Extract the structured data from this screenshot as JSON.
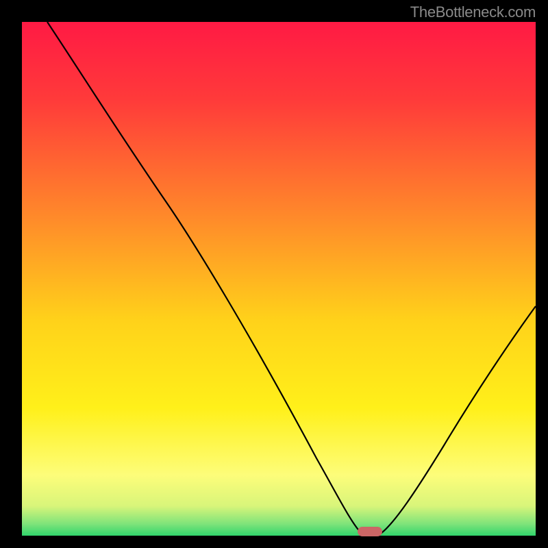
{
  "watermark": "TheBottleneck.com",
  "chart_data": {
    "type": "line",
    "title": "",
    "xlabel": "",
    "ylabel": "",
    "x_range": [
      0,
      100
    ],
    "y_range": [
      0,
      100
    ],
    "background": {
      "type": "vertical_gradient",
      "stops": [
        {
          "pos": 0.0,
          "color": "#ff1a44"
        },
        {
          "pos": 0.15,
          "color": "#ff3a3a"
        },
        {
          "pos": 0.38,
          "color": "#ff8a2a"
        },
        {
          "pos": 0.58,
          "color": "#ffd21a"
        },
        {
          "pos": 0.75,
          "color": "#fff01a"
        },
        {
          "pos": 0.88,
          "color": "#fdfd7a"
        },
        {
          "pos": 0.94,
          "color": "#d8f57a"
        },
        {
          "pos": 0.975,
          "color": "#7de37a"
        },
        {
          "pos": 1.0,
          "color": "#28d36a"
        }
      ]
    },
    "curve": {
      "description": "V-shaped bottleneck curve with minimum near x≈68",
      "points": [
        {
          "x": 5,
          "y": 100
        },
        {
          "x": 20,
          "y": 78
        },
        {
          "x": 28,
          "y": 65
        },
        {
          "x": 45,
          "y": 40
        },
        {
          "x": 58,
          "y": 15
        },
        {
          "x": 64,
          "y": 3
        },
        {
          "x": 66,
          "y": 0.5
        },
        {
          "x": 70,
          "y": 0.5
        },
        {
          "x": 74,
          "y": 3
        },
        {
          "x": 82,
          "y": 14
        },
        {
          "x": 92,
          "y": 30
        },
        {
          "x": 100,
          "y": 45
        }
      ]
    },
    "marker": {
      "x": 67.5,
      "y": 1.0,
      "color": "#cc6666"
    }
  }
}
